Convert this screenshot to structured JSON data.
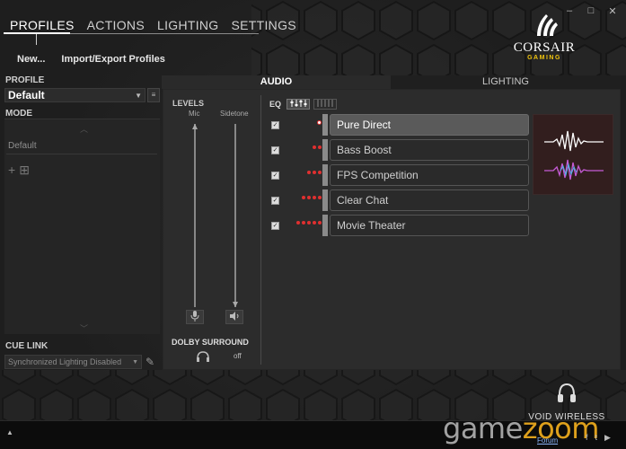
{
  "window": {
    "minimize_glyph": "–",
    "maximize_glyph": "□",
    "close_glyph": "✕"
  },
  "nav": {
    "tabs": [
      "PROFILES",
      "ACTIONS",
      "LIGHTING",
      "SETTINGS"
    ],
    "active": "PROFILES"
  },
  "logo": {
    "brand": "CORSAIR",
    "sub": "GAMING"
  },
  "profile_actions": {
    "new_label": "New...",
    "import_export_label": "Import/Export Profiles"
  },
  "profile": {
    "section_label": "PROFILE",
    "selected": "Default",
    "menu_glyph": "≡"
  },
  "mode": {
    "section_label": "MODE",
    "items": [
      "Default"
    ],
    "add_glyph": "+",
    "copy_glyph": "⊞"
  },
  "cue_link": {
    "section_label": "CUE LINK",
    "selected": "Synchronized Lighting Disabled"
  },
  "panel_tabs": {
    "audio": "AUDIO",
    "lighting": "LIGHTING",
    "active": "AUDIO"
  },
  "levels": {
    "title": "LEVELS",
    "mic_label": "Mic",
    "sidetone_label": "Sidetone",
    "mic_level": 1.0,
    "sidetone_level": 0.0,
    "mic_icon": "microphone-icon",
    "sidetone_icon": "speaker-icon"
  },
  "dolby": {
    "title": "DOLBY SURROUND",
    "state": "off",
    "icon": "headphones-icon"
  },
  "eq": {
    "label": "EQ",
    "presets": [
      {
        "name": "Pure Direct",
        "dots": 1,
        "checked": true,
        "selected": true
      },
      {
        "name": "Bass Boost",
        "dots": 2,
        "checked": true,
        "selected": false
      },
      {
        "name": "FPS Competition",
        "dots": 3,
        "checked": true,
        "selected": false
      },
      {
        "name": "Clear Chat",
        "dots": 4,
        "checked": true,
        "selected": false
      },
      {
        "name": "Movie Theater",
        "dots": 5,
        "checked": true,
        "selected": false
      }
    ],
    "preview_icon": "sound-wave-icon"
  },
  "device": {
    "name": "VOID WIRELESS"
  },
  "footer": {
    "forum_label": "Forum"
  },
  "watermark": {
    "part1": "game",
    "part2": "zoom"
  },
  "colors": {
    "accent_red": "#e03030",
    "brand_yellow": "#f1c40f",
    "selected_preset_bg": "#5a5a5a"
  }
}
